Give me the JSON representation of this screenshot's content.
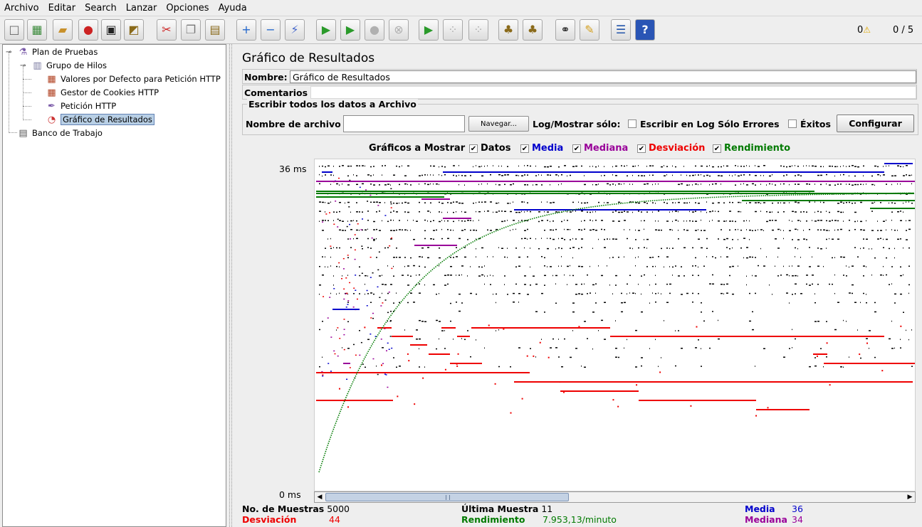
{
  "menu": [
    "Archivo",
    "Editar",
    "Search",
    "Lanzar",
    "Opciones",
    "Ayuda"
  ],
  "toolbar": {
    "buttons": [
      {
        "name": "new-icon",
        "glyph": "□",
        "color": "#666666"
      },
      {
        "name": "templates-icon",
        "glyph": "▦",
        "color": "#3a8a3a"
      },
      {
        "name": "open-icon",
        "glyph": "▰",
        "color": "#c8902a"
      },
      {
        "name": "close-file-icon",
        "glyph": "●",
        "color": "#cc2222"
      },
      {
        "name": "save-icon",
        "glyph": "▣",
        "color": "#222222"
      },
      {
        "name": "save-as-icon",
        "glyph": "◩",
        "color": "#8a6a1a"
      },
      {
        "name": "cut-icon",
        "glyph": "✂",
        "color": "#cc2222"
      },
      {
        "name": "copy-icon",
        "glyph": "❐",
        "color": "#777777"
      },
      {
        "name": "paste-icon",
        "glyph": "▤",
        "color": "#8a6a1a"
      },
      {
        "name": "expand-icon",
        "glyph": "+",
        "color": "#2266cc"
      },
      {
        "name": "collapse-icon",
        "glyph": "−",
        "color": "#2266cc"
      },
      {
        "name": "toggle-icon",
        "glyph": "⚡",
        "color": "#4466cc"
      },
      {
        "name": "start-icon",
        "glyph": "▶",
        "color": "#2a9a2a"
      },
      {
        "name": "start-no-pauses-icon",
        "glyph": "▶",
        "color": "#2a9a2a"
      },
      {
        "name": "stop-icon",
        "glyph": "●",
        "color": "#b0b0b0"
      },
      {
        "name": "shutdown-icon",
        "glyph": "⊗",
        "color": "#b0b0b0"
      },
      {
        "name": "remote-start-icon",
        "glyph": "▶",
        "color": "#2a9a2a"
      },
      {
        "name": "remote-stop-icon",
        "glyph": "⁘",
        "color": "#b0b0b0"
      },
      {
        "name": "remote-shutdown-icon",
        "glyph": "⁘",
        "color": "#b0b0b0"
      },
      {
        "name": "clear-icon",
        "glyph": "♣",
        "color": "#8a6a1a"
      },
      {
        "name": "clear-all-icon",
        "glyph": "♣",
        "color": "#8a6a1a"
      },
      {
        "name": "search-icon",
        "glyph": "⚭",
        "color": "#222222"
      },
      {
        "name": "reset-search-icon",
        "glyph": "✎",
        "color": "#d4a020"
      },
      {
        "name": "function-helper-icon",
        "glyph": "☰",
        "color": "#2255aa"
      },
      {
        "name": "help-icon",
        "glyph": "?",
        "color": "#ffffff"
      }
    ],
    "error_count": "0",
    "threads": "0 / 5"
  },
  "tree": {
    "nodes": [
      {
        "label": "Plan de Pruebas",
        "icon": "flask-icon"
      },
      {
        "label": "Grupo de Hilos",
        "icon": "spool-icon"
      },
      {
        "label": "Valores por Defecto para Petición HTTP",
        "icon": "config-element-icon"
      },
      {
        "label": "Gestor de Cookies HTTP",
        "icon": "config-element-icon"
      },
      {
        "label": "Petición HTTP",
        "icon": "sampler-icon"
      },
      {
        "label": "Gráfico de Resultados",
        "icon": "listener-icon"
      },
      {
        "label": "Banco de Trabajo",
        "icon": "workbench-icon"
      }
    ]
  },
  "panel": {
    "title": "Gráfico de Resultados",
    "name_label": "Nombre:",
    "name_value": "Gráfico de Resultados",
    "comments_label": "Comentarios"
  },
  "file_section": {
    "legend": "Escribir todos los datos a Archivo",
    "filename_label": "Nombre de archivo",
    "filename_value": "",
    "browse_label": "Navegar...",
    "log_label": "Log/Mostrar sólo:",
    "errors_label": "Escribir en Log Sólo Errores",
    "errors_checked": false,
    "success_label": "Éxitos",
    "success_checked": false,
    "configure_label": "Configurar"
  },
  "graphs": {
    "label": "Gráficos a Mostrar",
    "options": [
      {
        "label": "Datos",
        "checked": true,
        "color": "#000000"
      },
      {
        "label": "Media",
        "checked": true,
        "color": "#0000cc"
      },
      {
        "label": "Mediana",
        "checked": true,
        "color": "#990099"
      },
      {
        "label": "Desviación",
        "checked": true,
        "color": "#ee0000"
      },
      {
        "label": "Rendimiento",
        "checked": true,
        "color": "#007a00"
      }
    ]
  },
  "chart_data": {
    "type": "scatter",
    "y_max_label": "36 ms",
    "y_min_label": "0 ms",
    "ylim": [
      0,
      36
    ],
    "xlim": [
      0,
      5000
    ],
    "series_colors": {
      "data": "#000000",
      "average": "#0000cc",
      "median": "#990099",
      "deviation": "#ee0000",
      "throughput": "#007a00"
    },
    "average_ms": 36,
    "median_ms": 34,
    "deviation_ms": 44,
    "throughput_per_minute": 7953.13
  },
  "stats": {
    "samples_label": "No. de Muestras",
    "samples_value": "5000",
    "last_label": "Última Muestra",
    "last_value": "11",
    "average_label": "Media",
    "average_value": "36",
    "deviation_label": "Desviación",
    "deviation_value": "44",
    "throughput_label": "Rendimiento",
    "throughput_value": "7.953,13/minuto",
    "median_label": "Mediana",
    "median_value": "34"
  },
  "colors": {
    "deviation": "#ee0000",
    "throughput": "#007a00",
    "average": "#0000cc",
    "median": "#990099"
  }
}
